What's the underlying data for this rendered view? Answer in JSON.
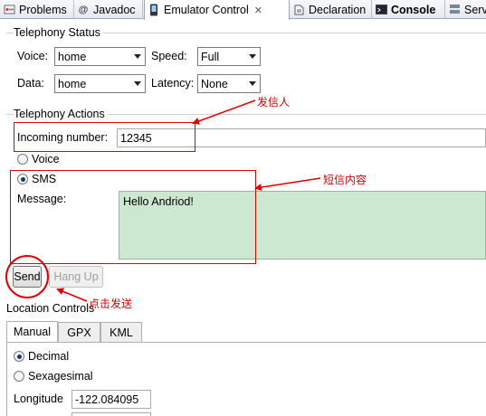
{
  "tabs": [
    {
      "label": "Problems",
      "icon": "problems-icon"
    },
    {
      "label": "Javadoc",
      "icon": "at-icon"
    },
    {
      "label": "Emulator Control",
      "icon": "phone-icon",
      "active": true
    },
    {
      "label": "Declaration",
      "icon": "declaration-icon"
    },
    {
      "label": "Console",
      "icon": "console-icon",
      "bold": true
    },
    {
      "label": "Serv",
      "icon": "servers-icon"
    }
  ],
  "telephony_status": {
    "title": "Telephony Status",
    "voice_label": "Voice:",
    "voice_value": "home",
    "speed_label": "Speed:",
    "speed_value": "Full",
    "data_label": "Data:",
    "data_value": "home",
    "latency_label": "Latency:",
    "latency_value": "None"
  },
  "telephony_actions": {
    "title": "Telephony Actions",
    "incoming_label": "Incoming number:",
    "incoming_value": "12345",
    "voice_option": "Voice",
    "sms_option": "SMS",
    "message_label": "Message:",
    "message_value": "Hello Andriod!",
    "send_label": "Send",
    "hangup_label": "Hang Up"
  },
  "location_controls": {
    "title": "Location Controls",
    "tabs": [
      "Manual",
      "GPX",
      "KML"
    ],
    "decimal_option": "Decimal",
    "sexagesimal_option": "Sexagesimal",
    "longitude_label": "Longitude",
    "longitude_value": "-122.084095"
  },
  "annotations": {
    "sender": "发信人",
    "sms_content": "短信内容",
    "click_send": "点击发送",
    "color": "#e00000"
  }
}
